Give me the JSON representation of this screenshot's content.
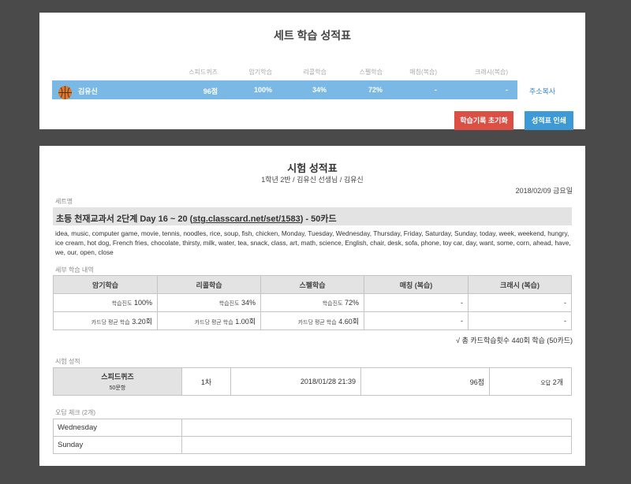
{
  "set_summary": {
    "title": "세트 학습 성적표",
    "headers": [
      "스피드퀴즈",
      "암기학습",
      "리콜학습",
      "스펠학습",
      "매칭(복습)",
      "크래시(복습)"
    ],
    "student_name": "김유신",
    "values": [
      "96점",
      "100%",
      "34%",
      "72%",
      "-",
      "-"
    ],
    "copy_address": "주소복사",
    "reset_button": "학습기록 초기화",
    "print_button": "성적표 인쇄",
    "accent_row_color": "#7ab9e5",
    "reset_color": "#dc4f45",
    "print_color": "#3d9ad6"
  },
  "exam_report": {
    "title": "시험 성적표",
    "subtitle": "1학년 2반 / 김유신 선생님 / 김유신",
    "date": "2018/02/09 금요일",
    "set_label": "세트명",
    "set_prefix": "초등 천재교과서 2단계 Day 16 ~ 20 (",
    "set_link": "stg.classcard.net/set/1583",
    "set_suffix": ") - 50카드",
    "words": "idea, music, computer game, movie, tennis, noodles, rice, soup, fish, chicken, Monday, Tuesday, Wednesday, Thursday, Friday, Saturday, Sunday, today, week, weekend, hungry, ice cream, hot dog, French fries, chocolate, thirsty, milk, water, tea, snack, class, art, math, science, English, chair, desk, sofa, phone, toy car, day, want, some, corn, ahead, have, we, our, open, close",
    "detail_label": "세부 학습 내역",
    "detail_headers": [
      "암기학습",
      "리콜학습",
      "스펠학습",
      "매칭 (복습)",
      "크래시 (복습)"
    ],
    "progress_row": [
      {
        "label": "학습진도",
        "value": "100%"
      },
      {
        "label": "학습진도",
        "value": "34%"
      },
      {
        "label": "학습진도",
        "value": "72%"
      },
      {
        "label": "",
        "value": "-"
      },
      {
        "label": "",
        "value": "-"
      }
    ],
    "avg_row": [
      {
        "label": "카드당 평균 학습",
        "value": "3.20회"
      },
      {
        "label": "카드당 평균 학습",
        "value": "1.00회"
      },
      {
        "label": "카드당 평균 학습",
        "value": "4.60회"
      },
      {
        "label": "",
        "value": "-"
      },
      {
        "label": "",
        "value": "-"
      }
    ],
    "total": "√ 총 카드학습횟수 440회 학습 (50카드)",
    "exam_label": "시험 성적",
    "exam": {
      "name": "스피드퀴즈",
      "count": "50문항",
      "order": "1차",
      "datetime": "2018/01/28 21:39",
      "score": "96점",
      "wrong_label": "오답",
      "wrong_value": "2개"
    },
    "wrong_label": "오답 체크 (2개)",
    "wrong_words": [
      "Wednesday",
      "Sunday"
    ]
  }
}
